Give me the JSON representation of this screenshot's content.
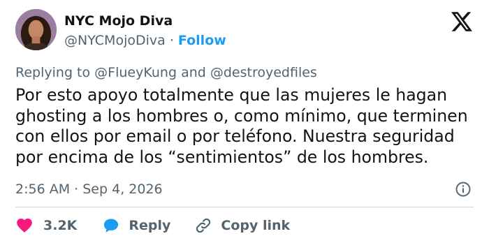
{
  "author": {
    "name": "NYC Mojo Diva",
    "handle": "@NYCMojoDiva",
    "separator": "·",
    "follow_label": "Follow"
  },
  "replying": {
    "prefix": "Replying to",
    "user1": "@FlueyKung",
    "conjunction": "and",
    "user2": "@destroyedfiles"
  },
  "tweet": {
    "lines": [
      "Por esto apoyo totalmente que las mujeres le hagan",
      "ghosting a los hombres o, como mínimo, que terminen",
      "con ellos por email o por teléfono. Nuestra seguridad",
      "por encima de los “sentimientos” de los hombres."
    ],
    "time": "2:56 AM",
    "date_separator": "·",
    "date": "Sep 4, 2026"
  },
  "actions": {
    "likes_count": "3.2K",
    "reply_label": "Reply",
    "copy_link_label": "Copy link"
  },
  "colors": {
    "text_primary": "#0f1419",
    "text_secondary": "#536471",
    "link": "#1d9bf0",
    "like_heart": "#f91880",
    "reply_bubble": "#1d9bf0",
    "divider": "#cfd9de"
  },
  "icons": [
    "x-logo-icon",
    "heart-icon",
    "reply-bubble-icon",
    "link-icon",
    "info-icon"
  ]
}
